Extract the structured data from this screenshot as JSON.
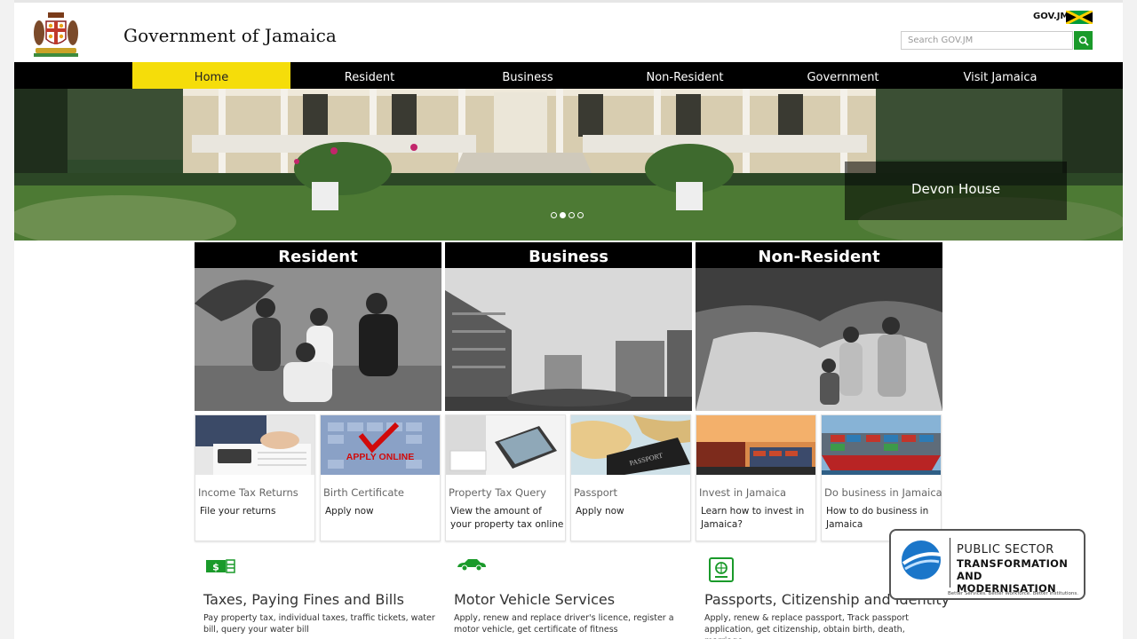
{
  "header": {
    "site_title": "Government of Jamaica",
    "govjm_label": "GOV.JM",
    "search_placeholder": "Search GOV.JM"
  },
  "nav": {
    "items": [
      {
        "label": "Home",
        "active": true
      },
      {
        "label": "Resident"
      },
      {
        "label": "Business"
      },
      {
        "label": "Non-Resident"
      },
      {
        "label": "Government"
      },
      {
        "label": "Visit Jamaica"
      }
    ]
  },
  "hero": {
    "caption": "Devon House",
    "slide_count": 4,
    "active_slide": 2
  },
  "categories": [
    {
      "label": "Resident"
    },
    {
      "label": "Business"
    },
    {
      "label": "Non-Resident"
    }
  ],
  "cards": [
    {
      "title": "Income Tax Returns",
      "sub": "File your returns"
    },
    {
      "title": "Birth Certificate",
      "sub": "Apply now",
      "image_text": "APPLY ONLINE"
    },
    {
      "title": "Property Tax Query",
      "sub": "View the amount of your property tax online"
    },
    {
      "title": "Passport",
      "sub": "Apply now",
      "image_text": "PASSPORT"
    },
    {
      "title": "Invest in Jamaica",
      "sub": "Learn how to invest in Jamaica?"
    },
    {
      "title": "Do business in Jamaica",
      "sub": "How to do business in Jamaica"
    }
  ],
  "services": [
    {
      "icon": "money-icon",
      "title": "Taxes, Paying Fines and Bills",
      "desc": "Pay property tax, individual taxes, traffic tickets, water bill, query your water bill"
    },
    {
      "icon": "car-icon",
      "title": "Motor Vehicle Services",
      "desc": "Apply, renew and replace driver's licence, register a motor vehicle, get certificate of fitness"
    },
    {
      "icon": "passport-icon",
      "title": "Passports, Citizenship and Identity",
      "desc": "Apply, renew & replace passport, Track passport application, get citizenship, obtain birth, death, marriage"
    }
  ],
  "pstm_badge": {
    "line1": "PUBLIC SECTOR",
    "line2": "TRANSFORMATION",
    "line3": "AND MODERNISATION",
    "tagline": "Better Services. Better Workforce. Better Institutions."
  },
  "colors": {
    "nav_bg": "#000000",
    "nav_active": "#f5dd0a",
    "search_button": "#1a9a2a",
    "services_icon": "#1a9a2a"
  }
}
